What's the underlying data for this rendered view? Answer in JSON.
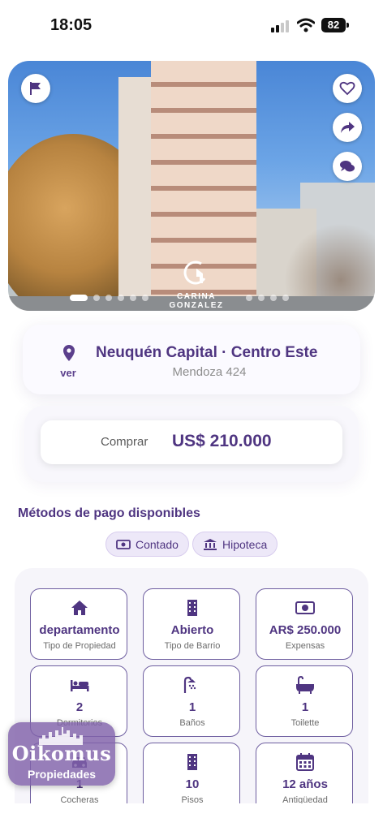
{
  "status_bar": {
    "time": "18:05",
    "battery": "82",
    "icons": [
      "signal-icon",
      "wifi-icon",
      "battery-icon"
    ]
  },
  "gallery": {
    "watermark": "CARINA GONZALEZ",
    "dot_count": 10,
    "active_index": 0,
    "actions": [
      "flag-icon",
      "heart-icon",
      "share-icon",
      "chat-icon"
    ]
  },
  "location": {
    "title": "Neuquén Capital · Centro Este",
    "address": "Mendoza 424",
    "map_link": "ver"
  },
  "price": {
    "operation": "Comprar",
    "amount": "US$ 210.000"
  },
  "payment": {
    "title": "Métodos de pago disponibles",
    "methods": [
      {
        "label": "Contado",
        "icon": "cash-icon"
      },
      {
        "label": "Hipoteca",
        "icon": "bank-icon"
      }
    ]
  },
  "features": [
    {
      "value": "departamento",
      "label": "Tipo de Propiedad",
      "icon": "home-icon"
    },
    {
      "value": "Abierto",
      "label": "Tipo de Barrio",
      "icon": "building-icon"
    },
    {
      "value": "AR$ 250.000",
      "label": "Expensas",
      "icon": "cash-icon"
    },
    {
      "value": "2",
      "label": "Dormitorios",
      "icon": "bed-icon"
    },
    {
      "value": "1",
      "label": "Baños",
      "icon": "shower-icon"
    },
    {
      "value": "1",
      "label": "Toilette",
      "icon": "bathtub-icon"
    },
    {
      "value": "1",
      "label": "Cocheras",
      "icon": "car-icon"
    },
    {
      "value": "10",
      "label": "Pisos",
      "icon": "building-icon"
    },
    {
      "value": "12 años",
      "label": "Antigüedad",
      "icon": "calendar-icon"
    }
  ],
  "brand": {
    "name": "Oikomus",
    "subtitle": "Propiedades"
  },
  "colors": {
    "accent": "#4f3581",
    "chip_bg": "#ede8f8",
    "brand_bg": "#8062aa"
  }
}
